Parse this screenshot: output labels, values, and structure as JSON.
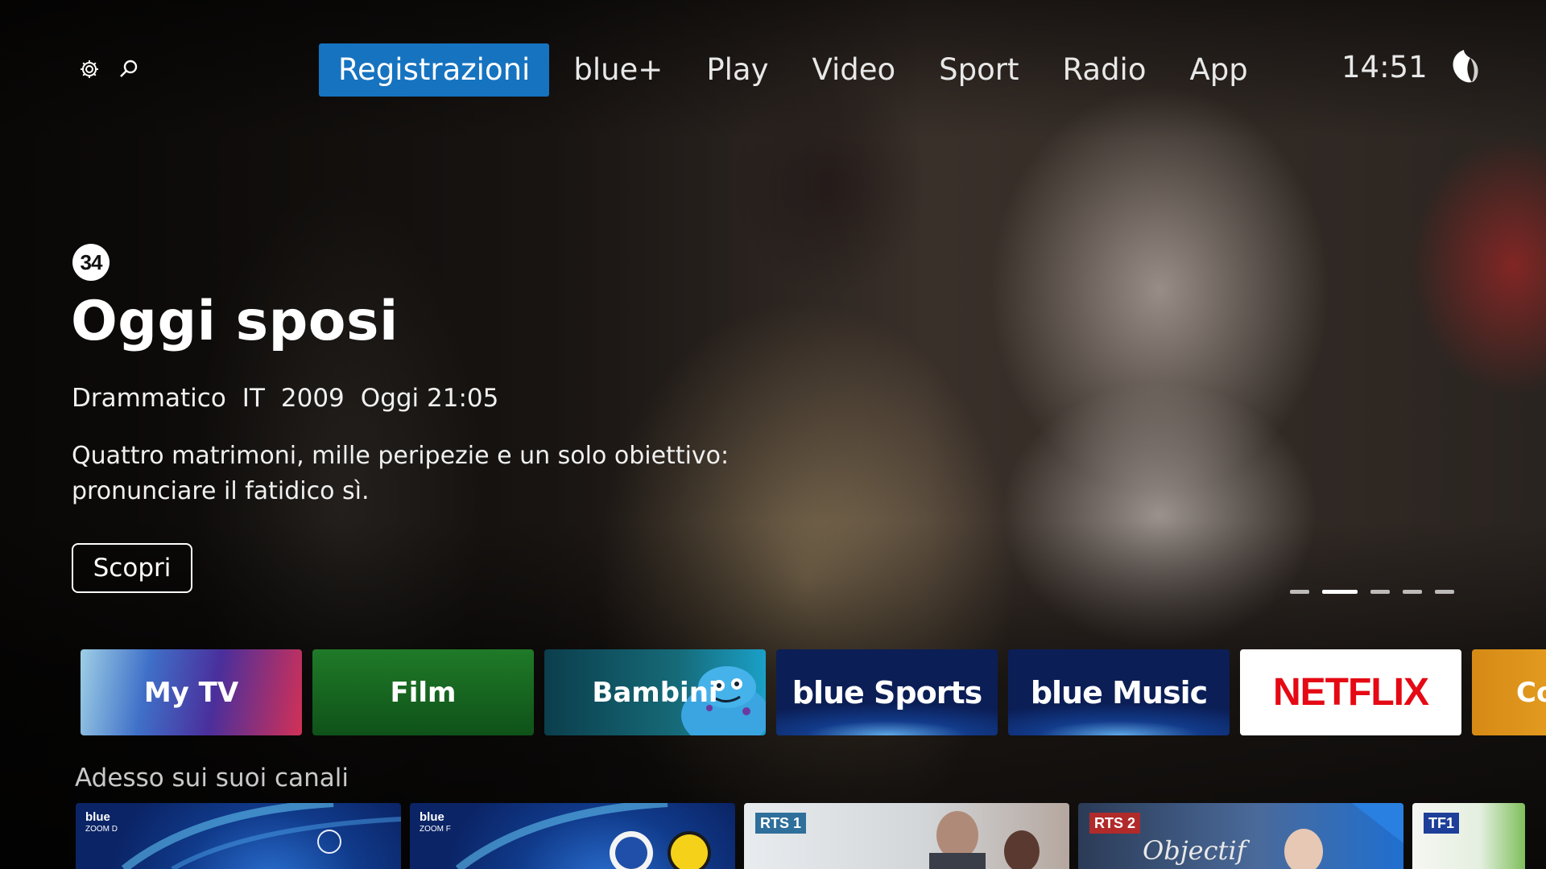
{
  "nav": {
    "settings_icon": "gear-icon",
    "search_icon": "search-icon",
    "items": [
      {
        "label": "Registrazioni",
        "active": true
      },
      {
        "label": "blue+",
        "active": false
      },
      {
        "label": "Play",
        "active": false
      },
      {
        "label": "Video",
        "active": false
      },
      {
        "label": "Sport",
        "active": false
      },
      {
        "label": "Radio",
        "active": false
      },
      {
        "label": "App",
        "active": false
      }
    ],
    "clock": "14:51",
    "profile_icon": "swisscom-logo-icon"
  },
  "hero": {
    "channel_logo": "34",
    "title": "Oggi sposi",
    "meta": [
      "Drammatico",
      "IT",
      "2009",
      "Oggi 21:05"
    ],
    "description_line1": "Quattro matrimoni, mille peripezie e un solo obiettivo:",
    "description_line2": "pronunciare il fatidico sì.",
    "cta_label": "Scopri",
    "carousel": {
      "count": 5,
      "active_index": 1
    }
  },
  "tiles": [
    {
      "label": "My TV",
      "kind": "mytv"
    },
    {
      "label": "Film",
      "kind": "film"
    },
    {
      "label": "Bambini",
      "kind": "bambini"
    },
    {
      "label": "blue Sports",
      "kind": "sports"
    },
    {
      "label": "blue Music",
      "kind": "music"
    },
    {
      "label": "NETFLIX",
      "kind": "netflix"
    },
    {
      "label": "Co",
      "kind": "co"
    }
  ],
  "section": {
    "title": "Adesso sui suoi canali"
  },
  "channels": [
    {
      "logo": "blue",
      "sub": "ZOOM D"
    },
    {
      "logo": "blue",
      "sub": "ZOOM F"
    },
    {
      "logo": "RTS 1"
    },
    {
      "logo": "RTS 2",
      "program_text": "Objectif"
    },
    {
      "logo": "TF1"
    }
  ],
  "colors": {
    "accent": "#1673c0",
    "netflix_red": "#e50914"
  }
}
